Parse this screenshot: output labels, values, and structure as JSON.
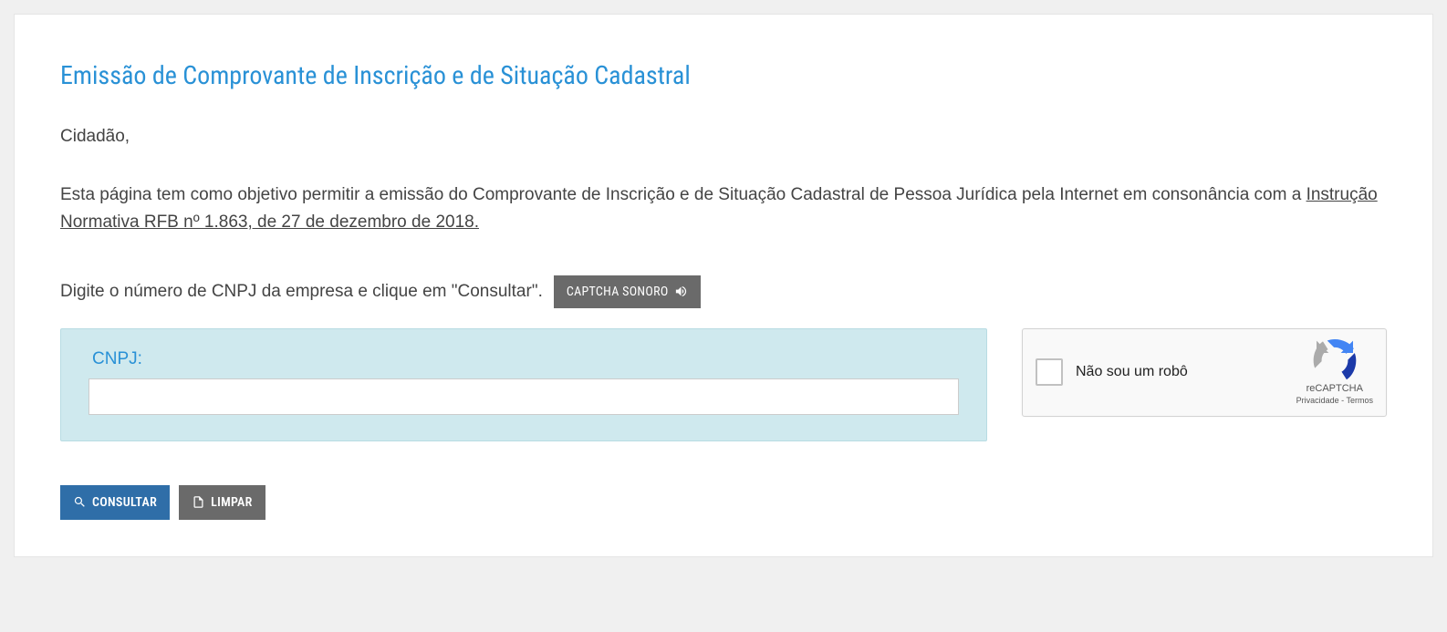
{
  "title": "Emissão de Comprovante de Inscrição e de Situação Cadastral",
  "greeting": "Cidadão,",
  "description_before_link": "Esta página tem como objetivo permitir a emissão do Comprovante de Inscrição e de Situação Cadastral de Pessoa Jurídica pela Internet em consonância com a ",
  "description_link": "Instrução Normativa RFB nº 1.863, de 27 de dezembro de 2018.",
  "instruction": "Digite o número de CNPJ da empresa e clique em \"Consultar\".",
  "captcha_button": "CAPTCHA SONORO",
  "cnpj_label": "CNPJ:",
  "cnpj_value": "",
  "recaptcha": {
    "label": "Não sou um robô",
    "brand": "reCAPTCHA",
    "privacy": "Privacidade",
    "terms": "Termos",
    "separator": " - "
  },
  "buttons": {
    "consultar": "CONSULTAR",
    "limpar": "LIMPAR"
  }
}
